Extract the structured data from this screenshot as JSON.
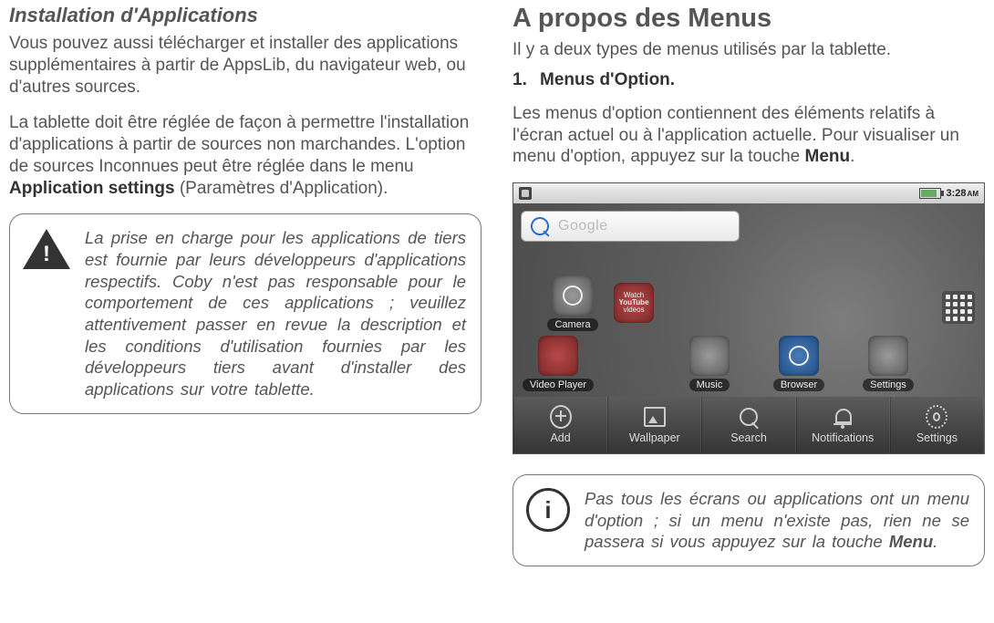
{
  "left": {
    "heading": "Installation d'Applications",
    "para1": "Vous pouvez aussi télécharger et installer des applications supplémentaires à partir de AppsLib, du navigateur web, ou d'autres sources.",
    "para2_pre": "La tablette doit être réglée de façon à permettre l'installation d'applications à partir de sources non marchandes. L'option de sources Inconnues peut être réglée dans le menu ",
    "para2_bold": "Application settings",
    "para2_post": " (Paramètres d'Application).",
    "warn_text": "La prise en charge pour les applications de tiers est fournie par leurs développeurs d'applications respectifs. Coby n'est pas responsable pour le comportement de ces applications ; veuillez attentivement passer en revue la description et les conditions d'utilisation fournies par les développeurs tiers avant d'installer des applications sur votre tablette."
  },
  "right": {
    "heading": "A propos des Menus",
    "intro": "Il y a deux types de menus utilisés par la tablette.",
    "list_num": "1.",
    "list_text": "Menus d'Option.",
    "para_pre": "Les menus d'option contiennent des éléments relatifs à l'écran actuel ou à l'application actuelle. Pour visualiser un menu d'option, appuyez sur la touche ",
    "para_bold": "Menu",
    "para_post": ".",
    "info_pre": "Pas tous les écrans ou applications ont un menu d'option ; si un menu n'existe pas, rien ne se passera si vous appuyez sur la touche ",
    "info_bold": "Menu",
    "info_post": "."
  },
  "tablet": {
    "time": "3:28",
    "ampm": "AM",
    "search_placeholder": "Google",
    "hs": {
      "camera": "Camera",
      "video": "Video Player",
      "music": "Music",
      "browser": "Browser",
      "settings": "Settings",
      "yt_line1": "Watch",
      "yt_line2": "YouTube",
      "yt_line3": "videos"
    },
    "menu": {
      "add": "Add",
      "wallpaper": "Wallpaper",
      "search": "Search",
      "notifications": "Notifications",
      "settings": "Settings"
    }
  },
  "icons": {
    "warn": "!",
    "info": "i"
  }
}
